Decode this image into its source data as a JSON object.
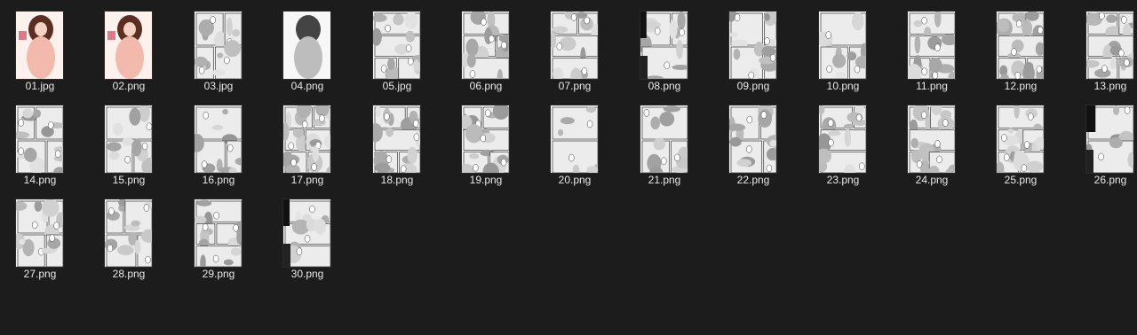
{
  "files": [
    {
      "name": "01.jpg",
      "variant": "cover-color"
    },
    {
      "name": "02.png",
      "variant": "cover-color"
    },
    {
      "name": "03.jpg",
      "variant": "panel"
    },
    {
      "name": "04.png",
      "variant": "figure-gray"
    },
    {
      "name": "05.jpg",
      "variant": "panel"
    },
    {
      "name": "06.png",
      "variant": "panel"
    },
    {
      "name": "07.png",
      "variant": "panel"
    },
    {
      "name": "08.png",
      "variant": "panel-dark"
    },
    {
      "name": "09.png",
      "variant": "panel"
    },
    {
      "name": "10.png",
      "variant": "panel"
    },
    {
      "name": "11.png",
      "variant": "panel"
    },
    {
      "name": "12.png",
      "variant": "panel"
    },
    {
      "name": "13.png",
      "variant": "panel"
    },
    {
      "name": "14.png",
      "variant": "panel"
    },
    {
      "name": "15.png",
      "variant": "panel"
    },
    {
      "name": "16.png",
      "variant": "panel"
    },
    {
      "name": "17.png",
      "variant": "panel"
    },
    {
      "name": "18.png",
      "variant": "panel"
    },
    {
      "name": "19.png",
      "variant": "panel"
    },
    {
      "name": "20.png",
      "variant": "panel"
    },
    {
      "name": "21.png",
      "variant": "panel"
    },
    {
      "name": "22.png",
      "variant": "panel"
    },
    {
      "name": "23.png",
      "variant": "panel"
    },
    {
      "name": "24.png",
      "variant": "panel"
    },
    {
      "name": "25.png",
      "variant": "panel"
    },
    {
      "name": "26.png",
      "variant": "panel-dark"
    },
    {
      "name": "27.png",
      "variant": "panel"
    },
    {
      "name": "28.png",
      "variant": "panel"
    },
    {
      "name": "29.png",
      "variant": "panel"
    },
    {
      "name": "30.png",
      "variant": "panel-dark"
    }
  ],
  "colors": {
    "background": "#1c1c1c",
    "label_text": "#e8e8e8",
    "cover_pink": "#f2b9ad",
    "page_white": "#f4f4f4",
    "ink": "#3a3a3a"
  }
}
